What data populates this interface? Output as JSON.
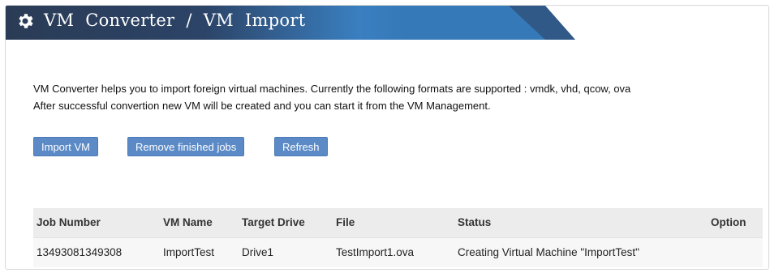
{
  "header": {
    "title": "VM  Converter  /  VM  Import",
    "icon": "gear-icon",
    "colors": {
      "dark": "#2b3a54",
      "accent": "#3d82c0"
    }
  },
  "intro": {
    "line1": "VM Converter helps you to import foreign virtual machines. Currently the following formats are supported : vmdk, vhd, qcow, ova",
    "line2": "After successful convertion new VM will be created and you can start it from the VM Management."
  },
  "buttons": {
    "import": "Import VM",
    "remove": "Remove finished jobs",
    "refresh": "Refresh",
    "color": "#5b8ac6"
  },
  "table": {
    "columns": [
      "Job Number",
      "VM Name",
      "Target Drive",
      "File",
      "Status",
      "Option"
    ],
    "rows": [
      [
        "13493081349308",
        "ImportTest",
        "Drive1",
        "TestImport1.ova",
        "Creating Virtual Machine \"ImportTest\"",
        ""
      ]
    ]
  }
}
